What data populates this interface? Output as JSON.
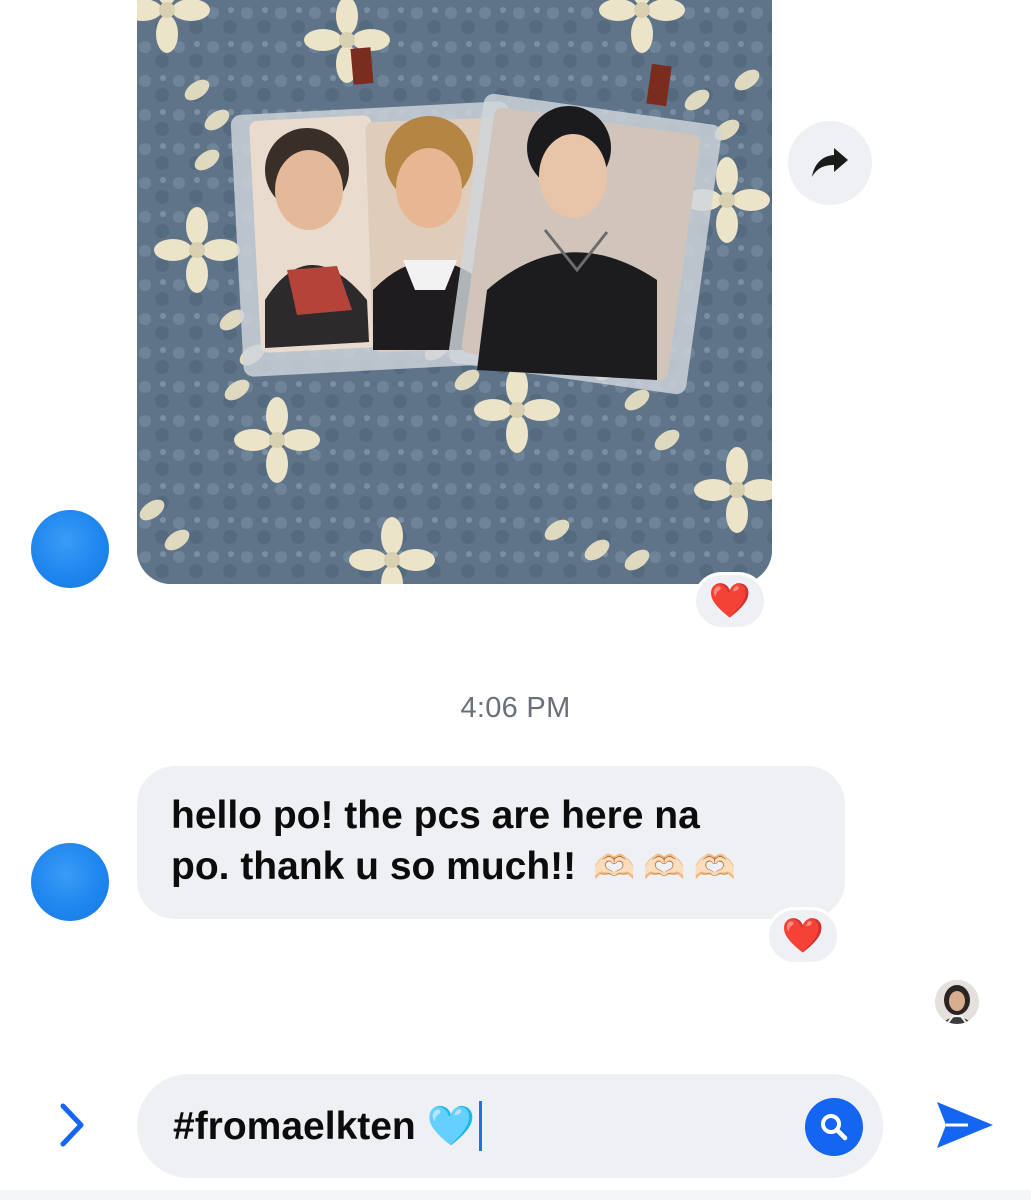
{
  "message_photo": {
    "icon": "photocard-photo-icon"
  },
  "colors": {
    "accent": "#1465f2",
    "bubble": "#eef0f3",
    "avatar": "#1f86ef",
    "heart": "#e0182e",
    "timestamp": "#6a6f78"
  },
  "reactions": [
    {
      "emoji": "❤️"
    },
    {
      "emoji": "❤️"
    }
  ],
  "timestamp": "4:06 PM",
  "message": {
    "line1": "hello po! the pcs are here na",
    "line2": "po. thank u so much!!",
    "emojis": [
      "🫶🏻",
      "🫶🏻",
      "🫶🏻"
    ]
  },
  "composer": {
    "value": "#fromaelkten 🩵"
  }
}
